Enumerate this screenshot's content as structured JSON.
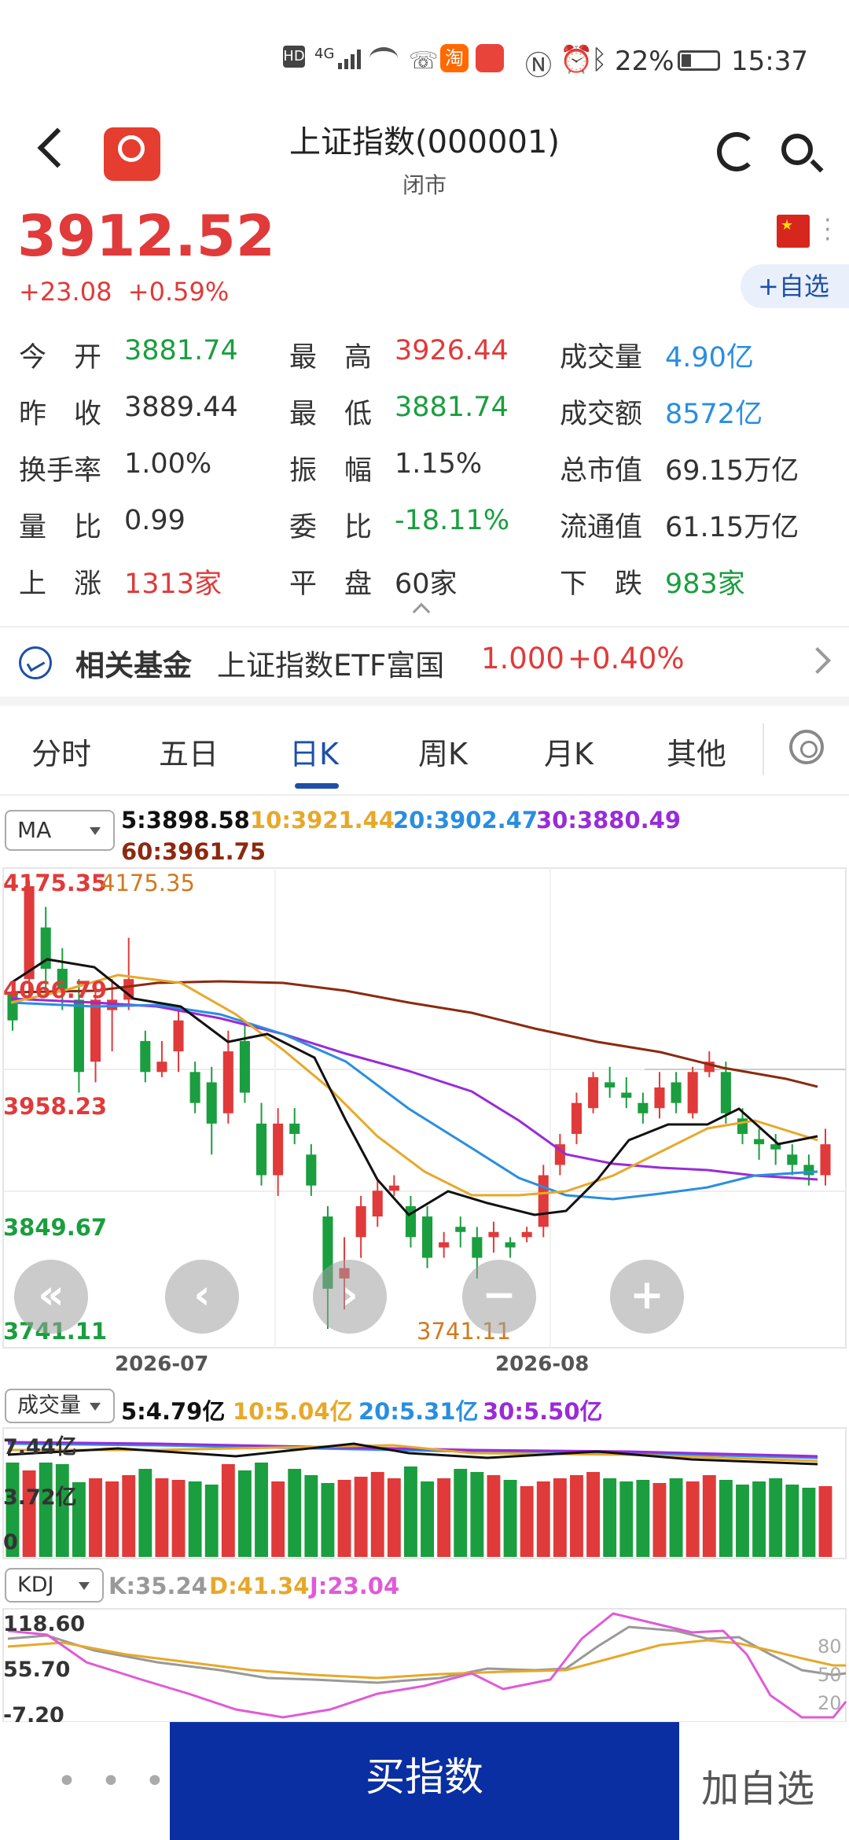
{
  "status_bar": {
    "network": "4G",
    "battery": "22%",
    "time": "15:37"
  },
  "header": {
    "title": "上证指数(000001)",
    "subtitle": "闭市"
  },
  "quote": {
    "price": "3912.52",
    "change": "+23.08",
    "change_pct": "+0.59%",
    "add_watch": "+自选"
  },
  "stats": {
    "rows": [
      [
        {
          "label": "今　开",
          "value": "3881.74",
          "color": "green"
        },
        {
          "label": "最　高",
          "value": "3926.44",
          "color": "red"
        },
        {
          "label": "成交量",
          "value": "4.90亿",
          "color": "blue"
        }
      ],
      [
        {
          "label": "昨　收",
          "value": "3889.44",
          "color": "none"
        },
        {
          "label": "最　低",
          "value": "3881.74",
          "color": "green"
        },
        {
          "label": "成交额",
          "value": "8572亿",
          "color": "blue"
        }
      ],
      [
        {
          "label": "换手率",
          "value": "1.00%",
          "color": "none"
        },
        {
          "label": "振　幅",
          "value": "1.15%",
          "color": "none"
        },
        {
          "label": "总市值",
          "value": "69.15万亿",
          "color": "none"
        }
      ],
      [
        {
          "label": "量　比",
          "value": "0.99",
          "color": "none"
        },
        {
          "label": "委　比",
          "value": "-18.11%",
          "color": "green"
        },
        {
          "label": "流通值",
          "value": "61.15万亿",
          "color": "none"
        }
      ],
      [
        {
          "label": "上　涨",
          "value": "1313家",
          "color": "red"
        },
        {
          "label": "平　盘",
          "value": "60家",
          "color": "none"
        },
        {
          "label": "下　跌",
          "value": "983家",
          "color": "green"
        }
      ]
    ]
  },
  "fund": {
    "title": "相关基金",
    "name": "上证指数ETF富国",
    "price": "1.000",
    "change": "+0.40%"
  },
  "tabs": [
    "分时",
    "五日",
    "日K",
    "周K",
    "月K",
    "其他"
  ],
  "active_tab": "日K",
  "ma": {
    "selector": "MA",
    "ma5": "5:3898.58",
    "ma10": "10:3921.44",
    "ma20": "20:3902.47",
    "ma30": "30:3880.49",
    "ma60": "60:3961.75"
  },
  "price_axis": {
    "high_label": "4175.35",
    "high_marker": "4175.35",
    "upper_mid": "4066.79",
    "mid": "3958.23",
    "lower_mid": "3849.67",
    "low_label": "3741.11",
    "low_marker": "3741.11"
  },
  "date_axis": [
    "2026-07",
    "2026-08"
  ],
  "volume": {
    "selector": "成交量",
    "ma5": "5:4.79亿",
    "ma10": "10:5.04亿",
    "ma20": "20:5.31亿",
    "ma30": "30:5.50亿",
    "axis": [
      "7.44亿",
      "3.72亿",
      "0"
    ]
  },
  "kdj": {
    "selector": "KDJ",
    "k": "K:35.24",
    "d": "D:41.34",
    "j": "J:23.04",
    "axis": [
      "118.60",
      "55.70",
      "-7.20"
    ],
    "levels": [
      "80",
      "50",
      "20"
    ]
  },
  "chart_controls": [
    "«",
    "‹",
    "›",
    "−",
    "+"
  ],
  "bottom": {
    "more": "• • •",
    "buy": "买指数",
    "add": "加自选"
  },
  "colors": {
    "up": "#e03a3a",
    "down": "#1a9e3f",
    "accent": "#0a2fa3",
    "ma5": "#111111",
    "ma10": "#e7a82a",
    "ma20": "#2a8ee0",
    "ma30": "#9a2bd8",
    "ma60": "#8b2a10"
  },
  "chart_data": {
    "type": "candlestick",
    "y_range": [
      3741.11,
      4175.35
    ],
    "candles": [
      [
        4066.0,
        4040.0,
        4070.0,
        4030.0
      ],
      [
        4080.0,
        4170.0,
        4175.35,
        4060.0
      ],
      [
        4130.0,
        4090.0,
        4150.0,
        4070.0
      ],
      [
        4090.0,
        4070.0,
        4110.0,
        4050.0
      ],
      [
        4060.0,
        3990.0,
        4080.0,
        3970.0
      ],
      [
        4000.0,
        4060.0,
        4070.0,
        3980.0
      ],
      [
        4050.0,
        4060.0,
        4080.0,
        4010.0
      ],
      [
        4060.0,
        4080.0,
        4120.0,
        4050.0
      ],
      [
        4020.0,
        3990.0,
        4030.0,
        3980.0
      ],
      [
        3990.0,
        4000.0,
        4020.0,
        3985.0
      ],
      [
        4010.0,
        4040.0,
        4050.0,
        3990.0
      ],
      [
        3990.0,
        3960.0,
        4000.0,
        3950.0
      ],
      [
        3980.0,
        3940.0,
        3995.0,
        3910.0
      ],
      [
        3950.0,
        4010.0,
        4030.0,
        3940.0
      ],
      [
        4020.0,
        3970.0,
        4040.0,
        3960.0
      ],
      [
        3940.0,
        3890.0,
        3960.0,
        3880.0
      ],
      [
        3890.0,
        3940.0,
        3955.0,
        3870.0
      ],
      [
        3940.0,
        3930.0,
        3955.0,
        3920.0
      ],
      [
        3910.0,
        3880.0,
        3920.0,
        3870.0
      ],
      [
        3850.0,
        3780.0,
        3860.0,
        3741.11
      ],
      [
        3790.0,
        3800.0,
        3830.0,
        3760.0
      ],
      [
        3830.0,
        3860.0,
        3870.0,
        3810.0
      ],
      [
        3850.0,
        3875.0,
        3885.0,
        3840.0
      ],
      [
        3875.0,
        3880.0,
        3890.0,
        3870.0
      ],
      [
        3860.0,
        3830.0,
        3870.0,
        3820.0
      ],
      [
        3850.0,
        3810.0,
        3860.0,
        3800.0
      ],
      [
        3820.0,
        3825.0,
        3835.0,
        3810.0
      ],
      [
        3840.0,
        3835.0,
        3850.0,
        3820.0
      ],
      [
        3830.0,
        3810.0,
        3840.0,
        3790.0
      ],
      [
        3830.0,
        3835.0,
        3845.0,
        3815.0
      ],
      [
        3825.0,
        3820.0,
        3830.0,
        3810.0
      ],
      [
        3830.0,
        3835.0,
        3840.0,
        3825.0
      ],
      [
        3840.0,
        3890.0,
        3900.0,
        3830.0
      ],
      [
        3900.0,
        3920.0,
        3930.0,
        3890.0
      ],
      [
        3930.0,
        3960.0,
        3970.0,
        3920.0
      ],
      [
        3955.0,
        3985.0,
        3990.0,
        3950.0
      ],
      [
        3980.0,
        3975.0,
        3995.0,
        3965.0
      ],
      [
        3970.0,
        3965.0,
        3985.0,
        3955.0
      ],
      [
        3960.0,
        3950.0,
        3970.0,
        3940.0
      ],
      [
        3955.0,
        3975.0,
        3990.0,
        3945.0
      ],
      [
        3980.0,
        3960.0,
        3990.0,
        3950.0
      ],
      [
        3950.0,
        3990.0,
        3995.0,
        3945.0
      ],
      [
        3990.0,
        4000.0,
        4010.0,
        3985.0
      ],
      [
        3990.0,
        3950.0,
        4000.0,
        3940.0
      ],
      [
        3945.0,
        3930.0,
        3955.0,
        3920.0
      ],
      [
        3925.0,
        3920.0,
        3935.0,
        3905.0
      ],
      [
        3920.0,
        3915.0,
        3930.0,
        3900.0
      ],
      [
        3910.0,
        3900.0,
        3920.0,
        3890.0
      ],
      [
        3900.0,
        3890.0,
        3910.0,
        3880.0
      ],
      [
        3890.0,
        3920.0,
        3935.0,
        3880.0
      ]
    ]
  }
}
